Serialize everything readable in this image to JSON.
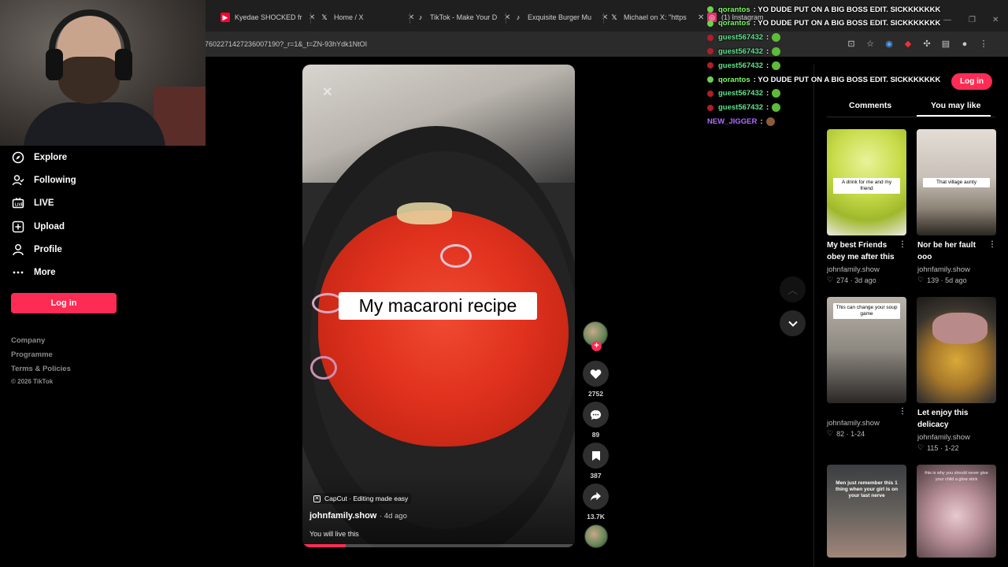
{
  "browser": {
    "tabs": [
      {
        "label": "Kyedae SHOCKED fro",
        "favicon": "youtube-icon",
        "color": "#ff0033"
      },
      {
        "label": "Home / X",
        "favicon": "x-icon",
        "color": "#ffffff"
      },
      {
        "label": "TikTok - Make Your D",
        "favicon": "tiktok-icon",
        "color": "#ffffff"
      },
      {
        "label": "Exquisite Burger Mu",
        "favicon": "tiktok-icon",
        "color": "#ffffff"
      },
      {
        "label": "Michael on X: \"https",
        "favicon": "x-icon",
        "color": "#ffffff"
      },
      {
        "label": "(1) Instagram",
        "favicon": "instagram-icon",
        "color": "#e1306c"
      }
    ],
    "url": "7602271427236007190?_r=1&_t=ZN-93hYdk1NtOI"
  },
  "sidebar": {
    "items": [
      {
        "label": "Explore",
        "icon": "compass-icon"
      },
      {
        "label": "Following",
        "icon": "following-icon"
      },
      {
        "label": "LIVE",
        "icon": "live-icon"
      },
      {
        "label": "Upload",
        "icon": "upload-icon"
      },
      {
        "label": "Profile",
        "icon": "profile-icon"
      },
      {
        "label": "More",
        "icon": "more-icon"
      }
    ],
    "login_label": "Log in",
    "footer": {
      "links": [
        "Company",
        "Programme",
        "Terms & Policies"
      ],
      "copyright": "© 2026 TikTok"
    }
  },
  "video": {
    "caption": "My macaroni recipe",
    "capcut_label": "CapCut · Editing made easy",
    "author": "johnfamily.show",
    "date": "· 4d ago",
    "description": "You will live this",
    "progress": 0.16
  },
  "actions": {
    "likes": "2752",
    "comments": "89",
    "saves": "387",
    "shares": "13.7K"
  },
  "chat": [
    {
      "name": "qorantos",
      "message": ": YO DUDE PUT ON A BIG BOSS EDIT. SICKKKKKKK",
      "name_color": "#7cfc66",
      "badge_color": "#6ad34a"
    },
    {
      "name": "qorantos",
      "message": ": YO DUDE PUT ON A BIG BOSS EDIT. SICKKKKKKK",
      "name_color": "#7cfc66",
      "badge_color": "#6ad34a"
    },
    {
      "name": "guest567432",
      "message": ":",
      "name_color": "#5ee38a",
      "badge_color": "#b11d2a",
      "emote": true
    },
    {
      "name": "guest567432",
      "message": ":",
      "name_color": "#5ee38a",
      "badge_color": "#b11d2a",
      "emote": true
    },
    {
      "name": "guest567432",
      "message": ":",
      "name_color": "#5ee38a",
      "badge_color": "#b11d2a",
      "emote": true
    },
    {
      "name": "qorantos",
      "message": ": YO DUDE PUT ON A BIG BOSS EDIT. SICKKKKKKK",
      "name_color": "#7cfc66",
      "badge_color": "#6ad34a"
    },
    {
      "name": "guest567432",
      "message": ":",
      "name_color": "#5ee38a",
      "badge_color": "#b11d2a",
      "emote": true
    },
    {
      "name": "guest567432",
      "message": ":",
      "name_color": "#5ee38a",
      "badge_color": "#b11d2a",
      "emote": true
    },
    {
      "name": "NEW_JIGGER",
      "message": ":",
      "name_color": "#b06bff",
      "badge_color": "",
      "emote": true
    }
  ],
  "right_panel": {
    "login_label": "Log in",
    "tabs": [
      "Comments",
      "You may like"
    ],
    "cards": [
      {
        "thumb_text": "A drink for me and my friend",
        "title": "My best Friends obey me after this",
        "author": "johnfamily.show",
        "likes": "274",
        "age": "· 3d ago"
      },
      {
        "thumb_text": "That village aunty",
        "title": "Nor be her fault ooo",
        "author": "johnfamily.show",
        "likes": "139",
        "age": "· 5d ago"
      },
      {
        "thumb_text": "This can change your soup game",
        "title": "",
        "author": "johnfamily.show",
        "likes": "82",
        "age": "· 1-24"
      },
      {
        "thumb_text": "",
        "title": "Let enjoy this delicacy",
        "author": "johnfamily.show",
        "likes": "115",
        "age": "· 1-22"
      },
      {
        "thumb_text": "Men just remember this 1 thing when your girl is on your last nerve",
        "title": "",
        "author": "",
        "likes": "",
        "age": ""
      },
      {
        "thumb_text": "this is why you should never give your child a glow stick",
        "title": "",
        "author": "",
        "likes": "",
        "age": ""
      }
    ]
  },
  "colors": {
    "accent": "#fe2c55",
    "background": "#000000"
  }
}
